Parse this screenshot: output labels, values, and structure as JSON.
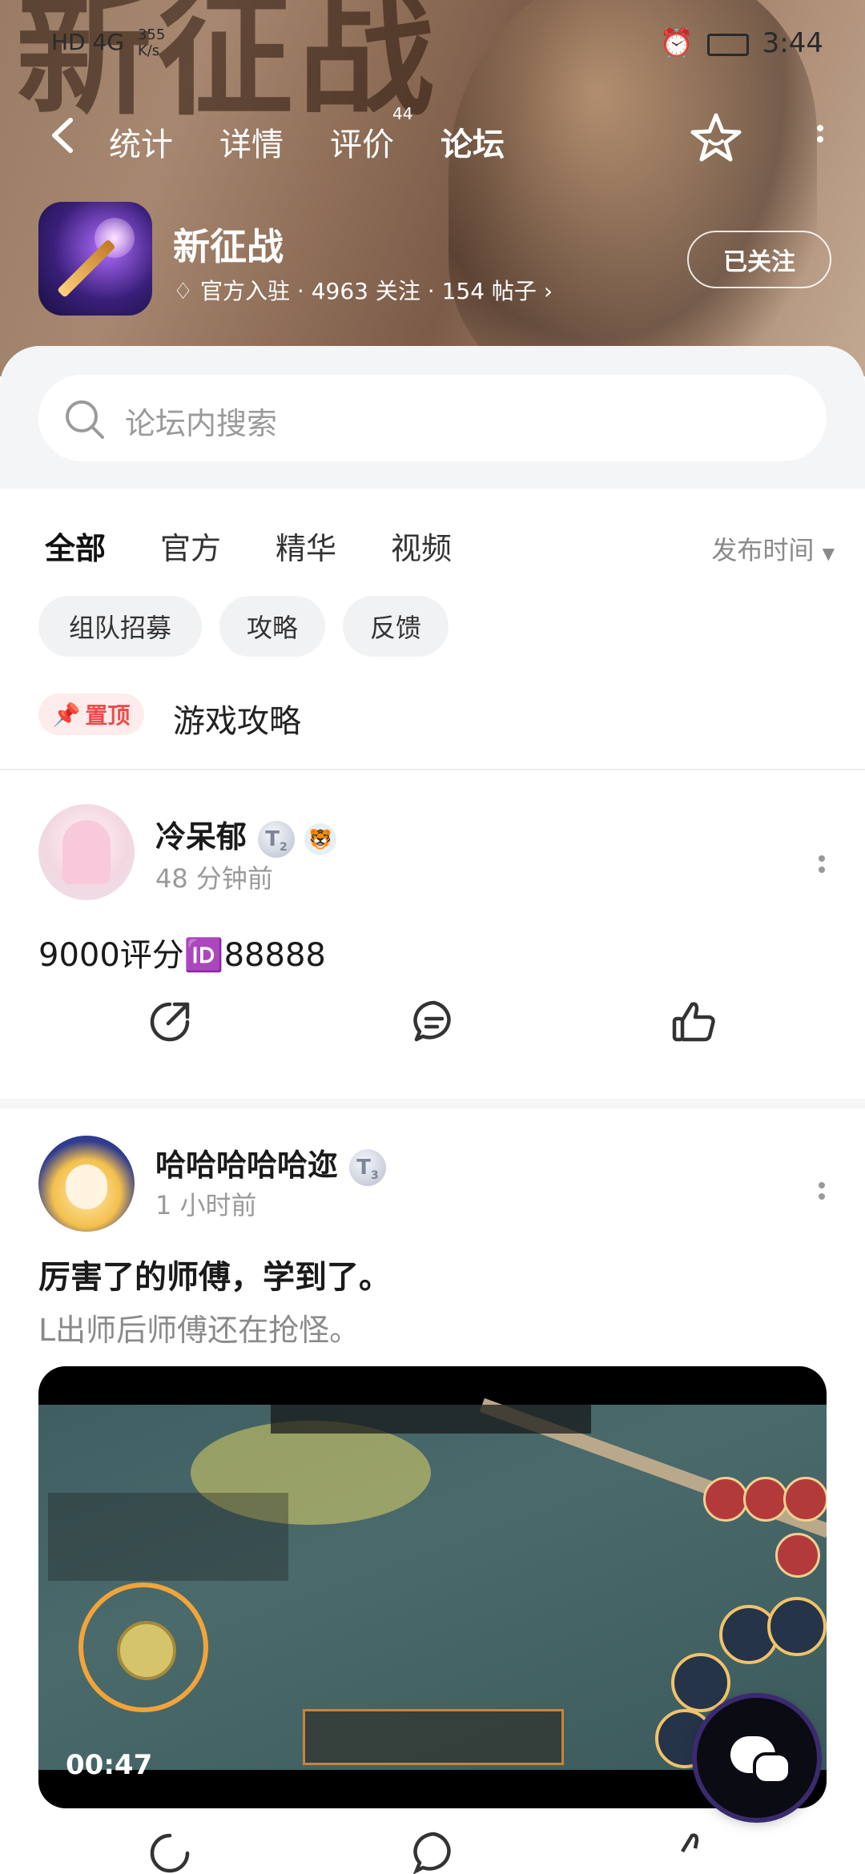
{
  "status_bar": {
    "left_network": "HD 4G",
    "speed_value": "355",
    "speed_unit": "K/s",
    "time": "3:44"
  },
  "hero": {
    "background_title": "新征战"
  },
  "nav": {
    "tabs": [
      {
        "label": "统计"
      },
      {
        "label": "详情"
      },
      {
        "label": "评价"
      },
      {
        "label": "论坛"
      }
    ],
    "review_count": "44",
    "active_tab": "论坛"
  },
  "app": {
    "name": "新征战",
    "meta": "官方入驻 · 4963 关注 · 154 帖子",
    "follow_label": "已关注"
  },
  "search": {
    "placeholder": "论坛内搜索"
  },
  "content_tabs": {
    "items": [
      "全部",
      "官方",
      "精华",
      "视频"
    ],
    "active": "全部",
    "sort_label": "发布时间"
  },
  "chips": [
    "组队招募",
    "攻略",
    "反馈"
  ],
  "pinned": {
    "badge": "置顶",
    "title": "游戏攻略"
  },
  "posts": [
    {
      "author": "冷呆郁",
      "level": "T",
      "level_sub": "2",
      "time": "48 分钟前",
      "text": "9000评分🆔88888"
    },
    {
      "author": "哈哈哈哈哈迩",
      "level": "T",
      "level_sub": "3",
      "time": "1 小时前",
      "title": "厉害了的师傅，学到了。",
      "subtitle": "L出师后师傅还在抢怪。",
      "video_duration": "00:47"
    }
  ],
  "colors": {
    "accent": "#1bd1a5",
    "pin_red": "#ee4b4b"
  }
}
